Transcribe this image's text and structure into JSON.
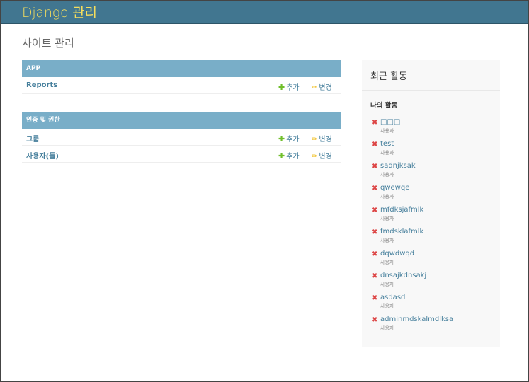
{
  "header": {
    "brand": "Django 관리"
  },
  "page": {
    "title": "사이트 관리"
  },
  "modules": [
    {
      "caption": "APP",
      "rows": [
        {
          "name": "Reports",
          "add": "추가",
          "change": "변경"
        }
      ]
    },
    {
      "caption": "인증 및 권한",
      "rows": [
        {
          "name": "그룹",
          "add": "추가",
          "change": "변경"
        },
        {
          "name": "사용자(들)",
          "add": "추가",
          "change": "변경"
        }
      ]
    }
  ],
  "recent": {
    "title": "최근 활동",
    "mine_title": "나의 활동",
    "actions": [
      {
        "label": "□□□",
        "type": "사용자"
      },
      {
        "label": "test",
        "type": "사용자"
      },
      {
        "label": "sadnjksak",
        "type": "사용자"
      },
      {
        "label": "qwewqe",
        "type": "사용자"
      },
      {
        "label": "mfdksjafmlk",
        "type": "사용자"
      },
      {
        "label": "fmdsklafmlk",
        "type": "사용자"
      },
      {
        "label": "dqwdwqd",
        "type": "사용자"
      },
      {
        "label": "dnsajkdnsakj",
        "type": "사용자"
      },
      {
        "label": "asdasd",
        "type": "사용자"
      },
      {
        "label": "adminmdskalmdlksa",
        "type": "사용자"
      }
    ]
  },
  "icons": {
    "add": "plus-icon",
    "change": "pencil-icon",
    "delete": "x-icon"
  },
  "colors": {
    "header_bg": "#417690",
    "brand": "#f5dd5d",
    "module_caption_bg": "#79aec8",
    "link": "#447e9b",
    "add": "#70bf2b",
    "change": "#efb80b",
    "delete": "#dd4646"
  }
}
